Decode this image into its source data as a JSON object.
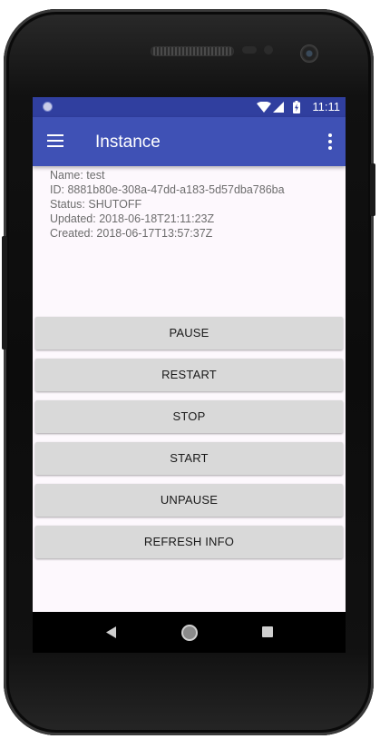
{
  "status_bar": {
    "time": "11:11"
  },
  "app_bar": {
    "title": "Instance",
    "menu_icon": "hamburger-menu-icon",
    "overflow_icon": "more-vert-icon"
  },
  "instance": {
    "name": "Name: test",
    "id": "ID: 8881b80e-308a-47dd-a183-5d57dba786ba",
    "status": "Status: SHUTOFF",
    "updated": "Updated: 2018-06-18T21:11:23Z",
    "created": "Created: 2018-06-17T13:57:37Z"
  },
  "actions": {
    "pause": "PAUSE",
    "restart": "RESTART",
    "stop": "STOP",
    "start": "START",
    "unpause": "UNPAUSE",
    "refresh": "REFRESH INFO"
  },
  "colors": {
    "status_bar": "#303f9f",
    "app_bar": "#3f51b5",
    "button": "#d9d9d9",
    "background": "#fdf8fd"
  }
}
